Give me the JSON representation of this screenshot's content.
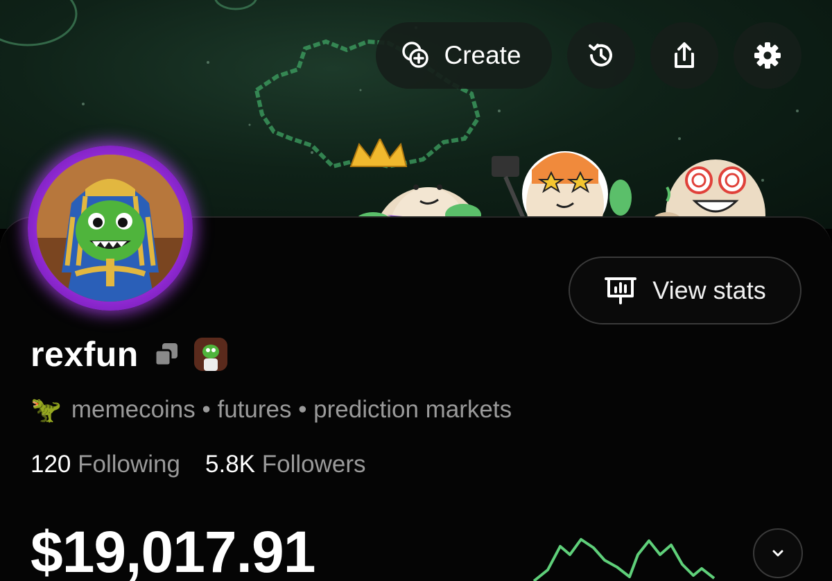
{
  "header": {
    "create_label": "Create",
    "icons": [
      "create-plus-icon",
      "history-icon",
      "share-icon",
      "settings-gear-icon"
    ]
  },
  "profile": {
    "view_stats_label": "View stats",
    "username": "rexfun",
    "bio_emoji": "🦖",
    "bio": "memecoins • futures • prediction markets",
    "following_count": "120",
    "following_label": "Following",
    "followers_count": "5.8K",
    "followers_label": "Followers",
    "balance": "$19,017.91"
  },
  "colors": {
    "accent_green": "#5fd07a",
    "avatar_ring": "#b23cf0",
    "muted_text": "#9a9a9a"
  }
}
